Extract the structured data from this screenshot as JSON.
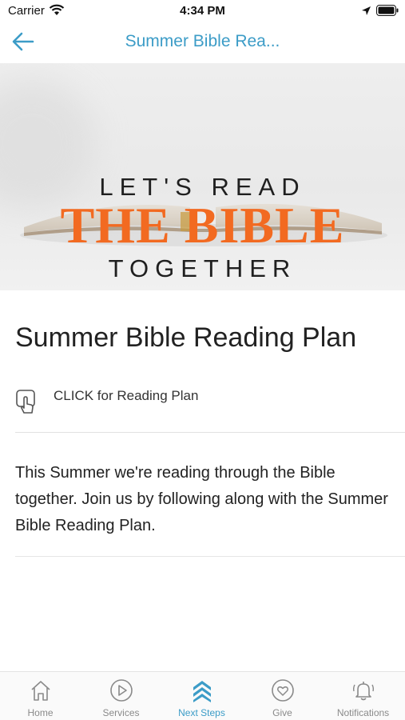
{
  "status_bar": {
    "carrier": "Carrier",
    "time": "4:34 PM"
  },
  "nav": {
    "title": "Summer Bible Rea..."
  },
  "hero": {
    "line1": "LET'S READ",
    "line2": "THE BIBLE",
    "line3": "TOGETHER"
  },
  "content": {
    "title": "Summer Bible Reading Plan",
    "link_label": "CLICK for Reading Plan",
    "description": "This Summer we're reading through the Bible together. Join us by following along with the Summer Bible Reading Plan."
  },
  "tabs": [
    {
      "label": "Home",
      "icon": "home-icon"
    },
    {
      "label": "Services",
      "icon": "play-icon"
    },
    {
      "label": "Next Steps",
      "icon": "chevrons-up-icon",
      "active": true
    },
    {
      "label": "Give",
      "icon": "heart-icon"
    },
    {
      "label": "Notifications",
      "icon": "bell-icon"
    }
  ],
  "colors": {
    "accent": "#3c9cc7",
    "hero_orange": "#f26a21",
    "text": "#222222"
  }
}
